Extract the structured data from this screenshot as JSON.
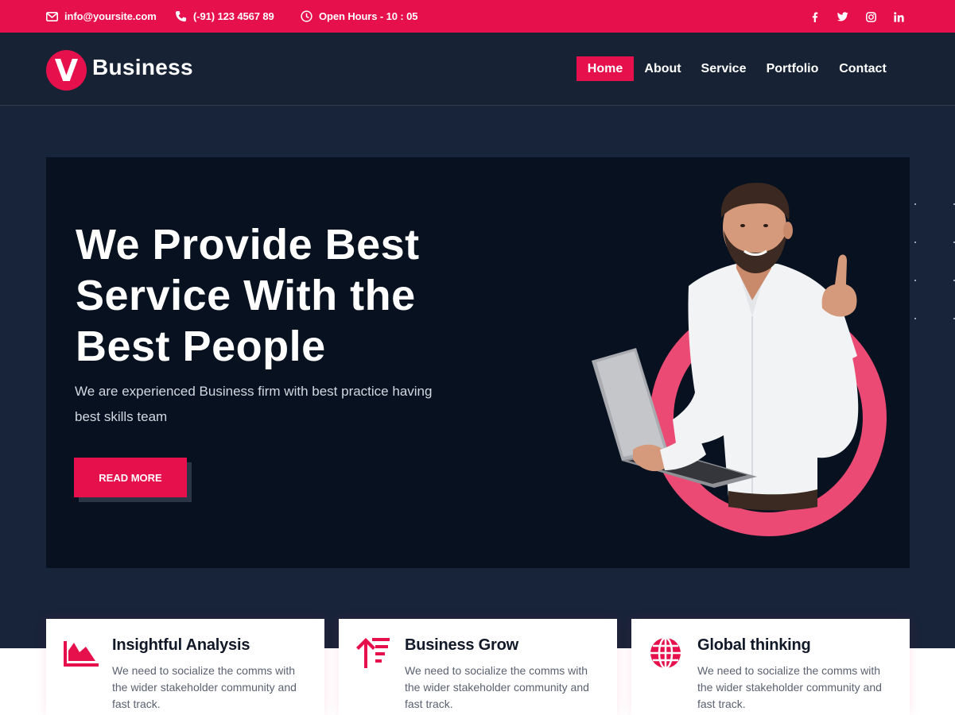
{
  "topbar": {
    "email": "info@yoursite.com",
    "phone": "(-91) 123 4567 89",
    "hours": "Open Hours - 10 : 05",
    "social": [
      {
        "icon": "facebook-icon",
        "glyph": "f"
      },
      {
        "icon": "twitter-icon",
        "glyph": "t"
      },
      {
        "icon": "instagram-icon",
        "glyph": "ig"
      },
      {
        "icon": "linkedin-icon",
        "glyph": "in"
      }
    ]
  },
  "brand": {
    "mark": "V",
    "name": "Business"
  },
  "nav": {
    "items": [
      "Home",
      "About",
      "Service",
      "Portfolio",
      "Contact"
    ],
    "active": "Home"
  },
  "hero": {
    "title": "We Provide Best Service With the Best People",
    "subtitle": "We are experienced Business firm with best practice having best skills team",
    "button": "READ MORE"
  },
  "features": [
    {
      "icon": "area-chart-icon",
      "title": "Insightful Analysis",
      "text": "We need to socialize the comms with the wider stakeholder community and fast track."
    },
    {
      "icon": "sort-arrow-icon",
      "title": "Business Grow",
      "text": "We need to socialize the comms with the wider stakeholder community and fast track."
    },
    {
      "icon": "globe-icon",
      "title": "Global thinking",
      "text": "We need to socialize the comms with the wider stakeholder community and fast track."
    }
  ],
  "colors": {
    "accent": "#e6104c",
    "dark": "#07111f",
    "header": "#172335"
  }
}
